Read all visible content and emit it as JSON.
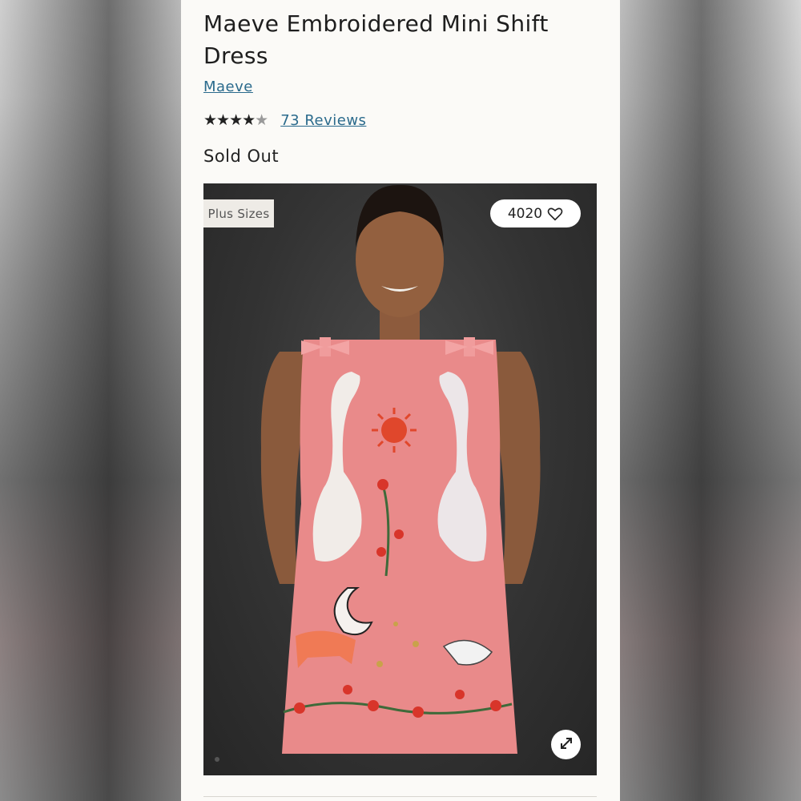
{
  "product": {
    "title": "Maeve Embroidered Mini Shift Dress",
    "brand": "Maeve",
    "rating": 4.5,
    "rating_max": 5,
    "stars_text_full": "★★★★",
    "stars_text_dim": "★",
    "reviews_label": "73 Reviews",
    "status": "Sold Out"
  },
  "image": {
    "badge": "Plus Sizes",
    "likes_count": "4020",
    "heart_icon": "heart-outline-icon",
    "expand_icon": "expand-icon"
  },
  "colors": {
    "link": "#2a6a8c",
    "dress": "#e98a8a",
    "backdrop": "#333333"
  }
}
